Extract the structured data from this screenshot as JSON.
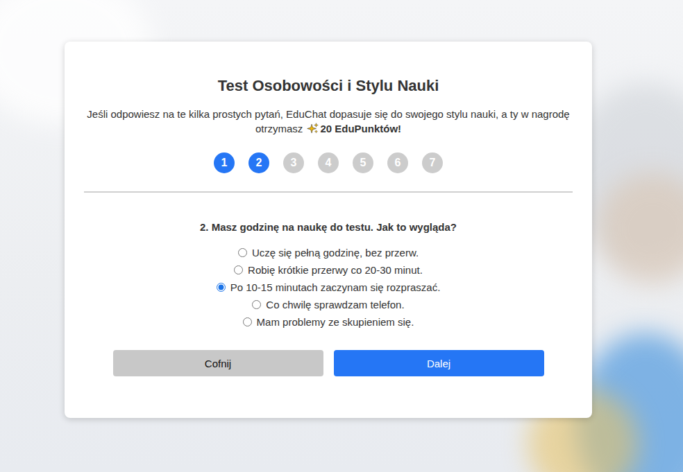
{
  "title": "Test Osobowości i Stylu Nauki",
  "description": {
    "text": "Jeśli odpowiesz na te kilka prostych pytań, EduChat dopasuje się do swojego stylu nauki, a ty w nagrodę otrzymasz",
    "reward": "20 EduPunktów!"
  },
  "steps": [
    {
      "label": "1",
      "active": true
    },
    {
      "label": "2",
      "active": true
    },
    {
      "label": "3",
      "active": false
    },
    {
      "label": "4",
      "active": false
    },
    {
      "label": "5",
      "active": false
    },
    {
      "label": "6",
      "active": false
    },
    {
      "label": "7",
      "active": false
    }
  ],
  "question": "2. Masz godzinę na naukę do testu. Jak to wygląda?",
  "options": [
    {
      "label": "Uczę się pełną godzinę, bez przerw.",
      "selected": false
    },
    {
      "label": "Robię krótkie przerwy co 20-30 minut.",
      "selected": false
    },
    {
      "label": "Po 10-15 minutach zaczynam się rozpraszać.",
      "selected": true
    },
    {
      "label": "Co chwilę sprawdzam telefon.",
      "selected": false
    },
    {
      "label": "Mam problemy ze skupieniem się.",
      "selected": false
    }
  ],
  "buttons": {
    "back": "Cofnij",
    "next": "Dalej"
  }
}
